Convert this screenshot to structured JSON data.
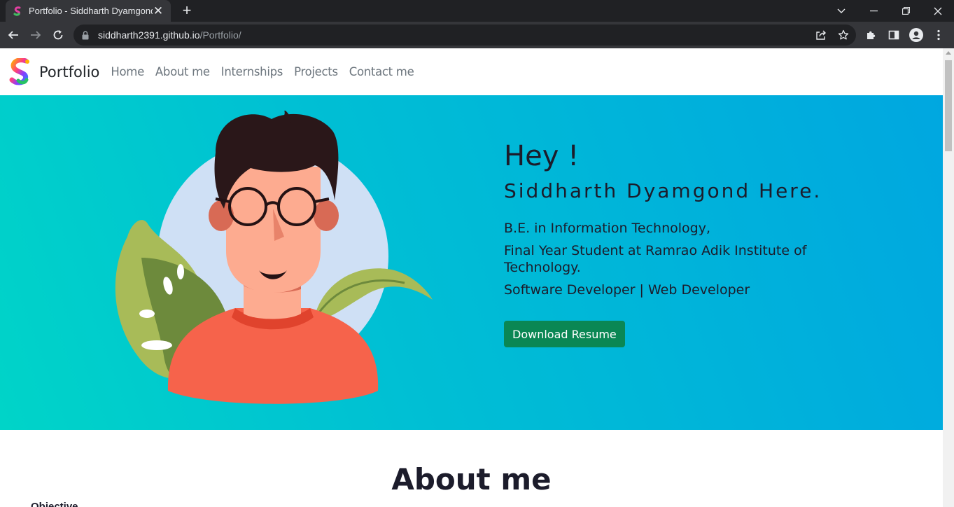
{
  "browser": {
    "tab_title": "Portfolio - Siddharth Dyamgond",
    "tab_close": "✕",
    "new_tab": "+",
    "url_host": "siddharth2391.github.io",
    "url_path": "/Portfolio/"
  },
  "navbar": {
    "brand": "Portfolio",
    "links": [
      "Home",
      "About me",
      "Internships",
      "Projects",
      "Contact me"
    ]
  },
  "hero": {
    "greeting": "Hey !",
    "name": "Siddharth Dyamgond Here.",
    "line1": "B.E. in Information Technology,",
    "line2": "Final Year Student at Ramrao Adik Institute of Technology.",
    "line3": "Software Developer | Web Developer",
    "button": "Download Resume"
  },
  "about": {
    "title": "About me",
    "subtitle": "Objective"
  },
  "colors": {
    "hero_gradient_start": "#00d4c8",
    "hero_gradient_end": "#00a7e0",
    "button": "#0a8754"
  }
}
